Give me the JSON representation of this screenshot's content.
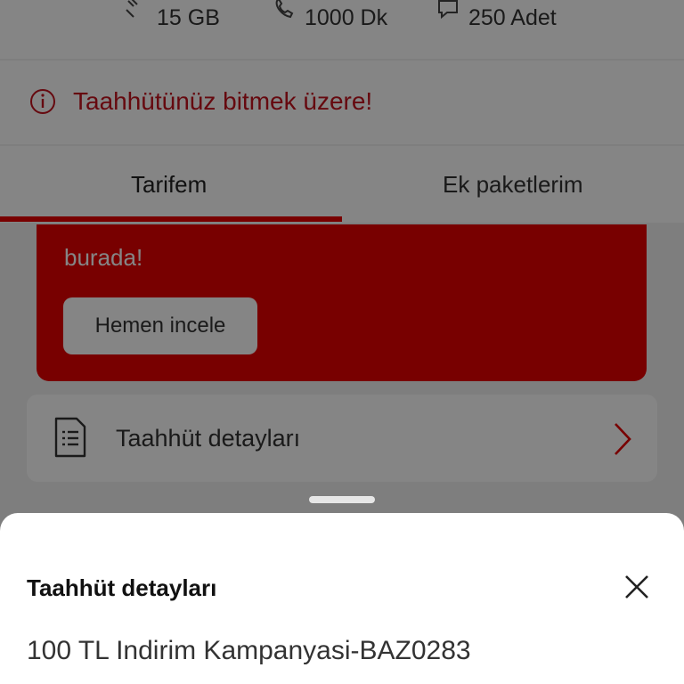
{
  "allowances": [
    {
      "icon": "data-icon",
      "value": "15 GB"
    },
    {
      "icon": "phone-icon",
      "value": "1000 Dk"
    },
    {
      "icon": "message-icon",
      "value": "250 Adet"
    }
  ],
  "warning": {
    "icon": "info-icon",
    "text": "Taahhütünüz bitmek üzere!"
  },
  "tabs": [
    {
      "label": "Tarifem",
      "active": true
    },
    {
      "label": "Ek paketlerim",
      "active": false
    }
  ],
  "promo": {
    "text": "burada!",
    "button_label": "Hemen incele"
  },
  "detail_row": {
    "icon": "document-icon",
    "label": "Taahhüt detayları",
    "chevron": "chevron-right-icon"
  },
  "sheet": {
    "title": "Taahhüt detayları",
    "close_icon": "close-icon",
    "value": "100 TL Indirim Kampanyasi-BAZ0283"
  },
  "colors": {
    "brand_red": "#e60000",
    "warning_red": "#c3121e",
    "sheet_bg": "#ffffff"
  }
}
